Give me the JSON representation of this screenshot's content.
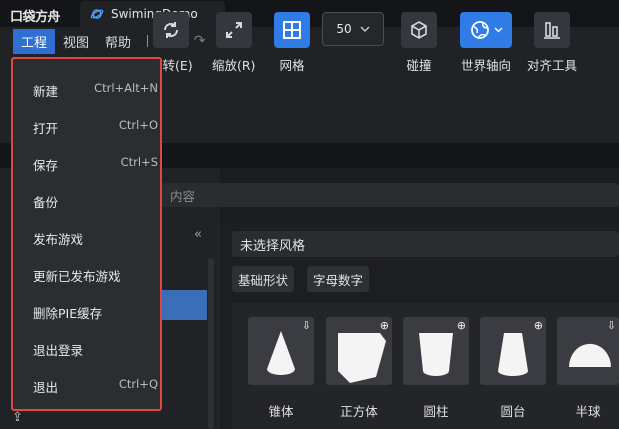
{
  "app": {
    "logo": "口袋方舟",
    "tab_title": "SwimingDemo"
  },
  "menubar": {
    "items": [
      "工程",
      "视图",
      "帮助"
    ],
    "separator": "|"
  },
  "toolbar": {
    "rotate_label": "旋转(E)",
    "scale_label": "缩放(R)",
    "grid_label": "网格",
    "grid_value": "50",
    "collision_label": "碰撞",
    "world_axis_label": "世界轴向",
    "align_label": "对齐工具"
  },
  "search": {
    "placeholder": "内容"
  },
  "style_select": {
    "value": "未选择风格"
  },
  "categories": [
    "基础形状",
    "字母数字"
  ],
  "shapes": [
    {
      "label": "锥体",
      "badge": "download"
    },
    {
      "label": "正方体",
      "badge": "zoom"
    },
    {
      "label": "圆柱",
      "badge": "zoom"
    },
    {
      "label": "圆台",
      "badge": "zoom"
    },
    {
      "label": "半球",
      "badge": "download"
    }
  ],
  "dropdown": {
    "items": [
      {
        "label": "新建",
        "shortcut": "Ctrl+Alt+N"
      },
      {
        "label": "打开",
        "shortcut": "Ctrl+O"
      },
      {
        "label": "保存",
        "shortcut": "Ctrl+S"
      },
      {
        "label": "备份",
        "shortcut": ""
      },
      {
        "label": "发布游戏",
        "shortcut": ""
      },
      {
        "label": "更新已发布游戏",
        "shortcut": ""
      },
      {
        "label": "删除PIE缓存",
        "shortcut": ""
      },
      {
        "label": "退出登录",
        "shortcut": ""
      },
      {
        "label": "退出",
        "shortcut": "Ctrl+Q"
      }
    ]
  },
  "colors": {
    "accent": "#2f7ce6",
    "highlight_border": "#e04646",
    "menu_active": "#2f6fd2"
  }
}
